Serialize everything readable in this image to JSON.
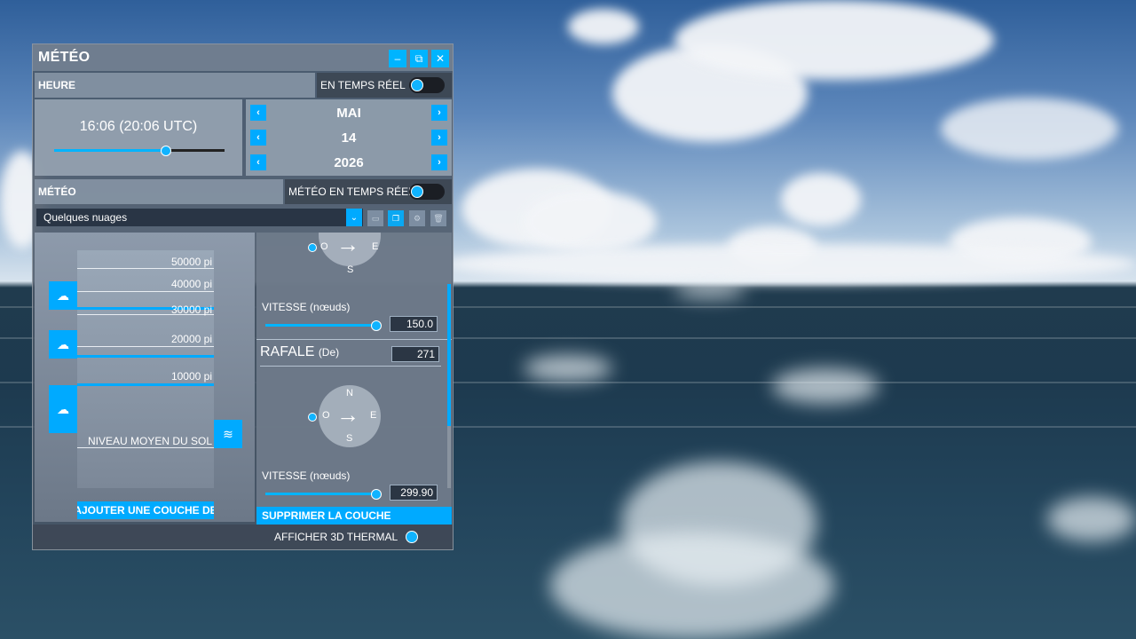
{
  "window": {
    "title": "MÉTÉO"
  },
  "time_section": {
    "header": "HEURE",
    "realtime_label": "EN TEMPS RÉEL",
    "time_value": "16:06 (20:06 UTC)",
    "time_slider_fraction": 0.65,
    "month": "MAI",
    "day": "14",
    "year": "2026"
  },
  "weather_section": {
    "header": "MÉTÉO",
    "realtime_label": "MÉTÉO EN TEMPS RÉEL",
    "preset": "Quelques nuages"
  },
  "layers": {
    "altitudes": [
      "50000 pi",
      "40000 pi",
      "30000 pi",
      "20000 pi",
      "10000 pi",
      "NIVEAU MOYEN DU SOL"
    ],
    "add_layer_label": "AJOUTER UNE COUCHE DE"
  },
  "wind": {
    "compass_labels": {
      "n": "N",
      "e": "E",
      "s": "S",
      "w": "O"
    },
    "speed_label": "VITESSE (nœuds)",
    "wind_speed": "150.0",
    "wind_speed_fraction": 1.0,
    "gust_title": "RAFALE",
    "gust_suffix": "(De)",
    "gust_direction": "271",
    "gust_speed_label": "VITESSE (nœuds)",
    "gust_speed": "299.90",
    "gust_speed_fraction": 1.0,
    "delete_layer_label": "SUPPRIMER LA COUCHE"
  },
  "footer": {
    "thermal_label": "AFFICHER 3D THERMAL"
  },
  "icons": {
    "minimize": "–",
    "popout": "⧉",
    "close": "✕",
    "chevron_left": "‹",
    "chevron_right": "›",
    "chevron_down": "⌄",
    "cloud": "☁",
    "wind": "≋",
    "save": "▭",
    "copy": "❐",
    "settings": "⚙",
    "trash": "🗑",
    "arrow": "→"
  },
  "colors": {
    "accent": "#00aaff"
  }
}
